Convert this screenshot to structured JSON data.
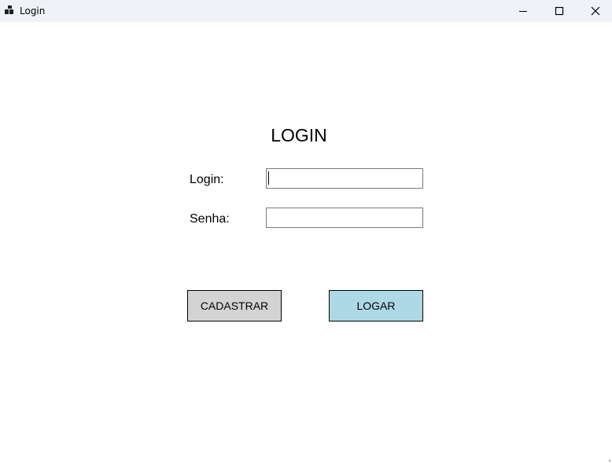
{
  "window": {
    "title": "Login",
    "controls": {
      "minimize": "minimize",
      "maximize": "maximize",
      "close": "close"
    }
  },
  "form": {
    "heading": "LOGIN",
    "login_label": "Login:",
    "login_value": "",
    "senha_label": "Senha:",
    "senha_value": ""
  },
  "buttons": {
    "cadastrar": "CADASTRAR",
    "logar": "LOGAR"
  },
  "colors": {
    "titlebar": "#eff2f7",
    "cadastrar_bg": "#d3d3d3",
    "logar_bg": "#add8e6"
  },
  "icons": {
    "app": "app-windows-icon",
    "minimize": "minimize-icon",
    "maximize": "maximize-icon",
    "close": "close-icon"
  }
}
